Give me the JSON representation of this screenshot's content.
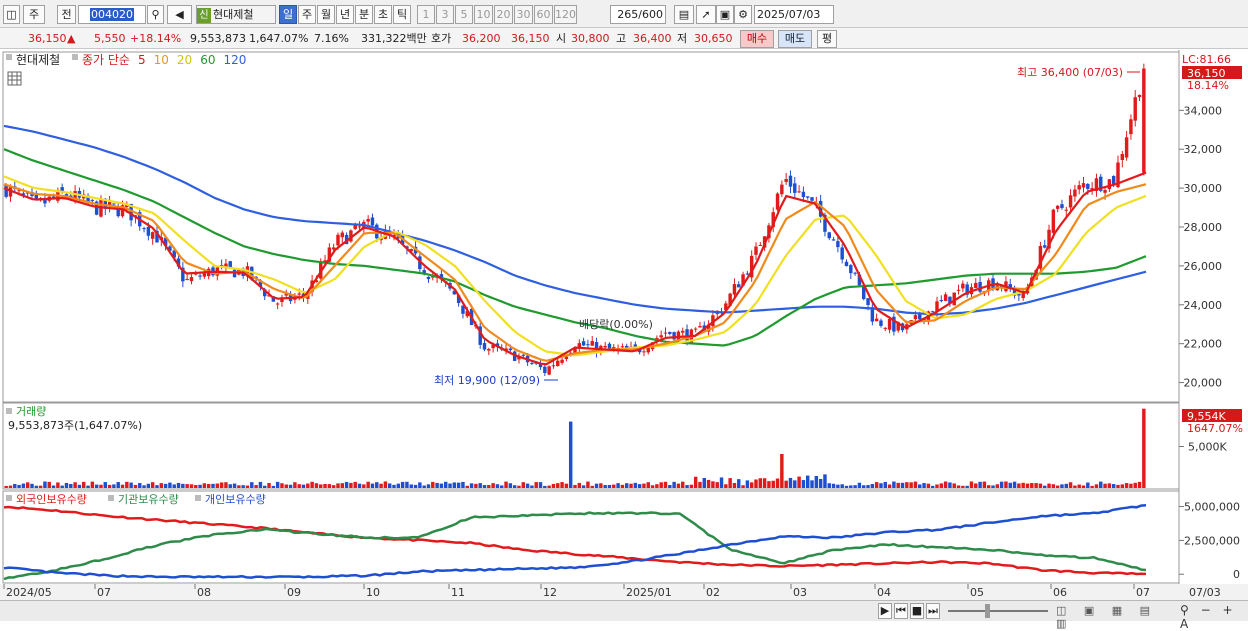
{
  "toolbar": {
    "period_main": "주",
    "period_prev": "전",
    "stock_code": "004020",
    "badge": "신",
    "stock_name": "현대제철",
    "periods": [
      "일",
      "주",
      "월",
      "년",
      "분",
      "초",
      "틱"
    ],
    "intervals": [
      "1",
      "3",
      "5",
      "10",
      "20",
      "30",
      "60",
      "120"
    ],
    "count": "265",
    "count_total": "/600",
    "date": "2025/07/03"
  },
  "quote": {
    "price": "36,150",
    "change": "5,550",
    "change_pct": "+18.14%",
    "volume": "9,553,873",
    "volume_pct": "1,647.07%",
    "turnover_pct": "7.16%",
    "trade_value": "331,322백만",
    "bid_label": "호가",
    "bid": "36,200",
    "ask": "36,150",
    "open_label": "시",
    "open": "30,800",
    "high_label": "고",
    "high": "36,400",
    "low_label": "저",
    "low": "30,650",
    "buy_label": "매수",
    "sell_label": "매도",
    "eval_label": "평"
  },
  "legend": {
    "stock": "현대제철",
    "ma_label": "종가 단순",
    "ma_periods": [
      "5",
      "10",
      "20",
      "60",
      "120"
    ],
    "lc": "LC:81.66",
    "last_price": "36,150",
    "last_pct": "18.14%",
    "max_note": "최고 36,400 (07/03)",
    "min_note": "최저 19,900 (12/09)",
    "dividend_note": "배당락(0.00%)"
  },
  "volume_panel": {
    "title": "거래량",
    "value": "9,553,873주(1,647.07%)",
    "last": "9,554K",
    "last_pct": "1647.07%",
    "axis_label": "5,000K"
  },
  "holders_panel": {
    "legends": [
      "외국인보유수량",
      "기관보유수량",
      "개인보유수량"
    ],
    "axis_labels": [
      "5,000,000",
      "2,500,000",
      "0"
    ]
  },
  "x_labels": [
    "2024/05",
    "07",
    "08",
    "09",
    "10",
    "11",
    "12",
    "2025/01",
    "02",
    "03",
    "04",
    "05",
    "06",
    "07",
    "07/03"
  ],
  "colors": {
    "up": "#e11b1b",
    "down": "#1f4fd1",
    "ma5": "#e11b1b",
    "ma10": "#f08a1a",
    "ma20": "#f0e020",
    "ma60": "#1f9a2f",
    "ma120": "#2f5fe0"
  },
  "chart_data": {
    "type": "candlestick",
    "y_range": [
      19000,
      37000
    ],
    "y_ticks": [
      20000,
      22000,
      24000,
      26000,
      28000,
      30000,
      32000,
      34000
    ],
    "y_tick_labels": [
      "20,000",
      "22,000",
      "24,000",
      "26,000",
      "28,000",
      "30,000",
      "32,000",
      "34,000"
    ],
    "price_path": [
      [
        "2024/05",
        30000
      ],
      [
        "2024/06",
        29100
      ],
      [
        "2024/06b",
        29700
      ],
      [
        "2024/07",
        29000
      ],
      [
        "2024/07b",
        28900
      ],
      [
        "2024/08",
        27600
      ],
      [
        "2024/08b",
        25200
      ],
      [
        "2024/08c",
        25800
      ],
      [
        "2024/09",
        25700
      ],
      [
        "2024/09b",
        24100
      ],
      [
        "2024/09c",
        24500
      ],
      [
        "2024/10",
        27200
      ],
      [
        "2024/10b",
        28100
      ],
      [
        "2024/10c",
        27300
      ],
      [
        "2024/11",
        25800
      ],
      [
        "2024/11b",
        24500
      ],
      [
        "2024/11c",
        21800
      ],
      [
        "2024/12",
        21400
      ],
      [
        "2024/12b",
        20600
      ],
      [
        "2024/12c",
        22000
      ],
      [
        "2025/01",
        21700
      ],
      [
        "2025/01b",
        21600
      ],
      [
        "2025/01c",
        22600
      ],
      [
        "2025/02",
        22400
      ],
      [
        "2025/02b",
        24000
      ],
      [
        "2025/03",
        26500
      ],
      [
        "2025/03b",
        30500
      ],
      [
        "2025/03c",
        29000
      ],
      [
        "2025/04",
        26500
      ],
      [
        "2025/04b",
        23200
      ],
      [
        "2025/04c",
        22700
      ],
      [
        "2025/05",
        23900
      ],
      [
        "2025/05b",
        24800
      ],
      [
        "2025/05c",
        25200
      ],
      [
        "2025/06",
        24400
      ],
      [
        "2025/06b",
        28600
      ],
      [
        "2025/06c",
        30200
      ],
      [
        "2025/07",
        30400
      ],
      [
        "2025/07/03",
        36150
      ]
    ],
    "series": [
      {
        "name": "5",
        "values": [
          30000,
          29400,
          29500,
          29050,
          28900,
          27900,
          25600,
          25700,
          25650,
          24300,
          24400,
          26800,
          28000,
          27500,
          26000,
          24800,
          22200,
          21400,
          20900,
          21800,
          21700,
          21600,
          22300,
          22400,
          23600,
          26000,
          29600,
          29200,
          27000,
          23800,
          22800,
          23600,
          24600,
          25100,
          24600,
          27800,
          29800,
          30200,
          30800
        ]
      },
      {
        "name": "10",
        "values": [
          30200,
          29700,
          29600,
          29200,
          29000,
          28300,
          26200,
          25600,
          25700,
          24800,
          24300,
          26000,
          27700,
          27700,
          26500,
          25300,
          22800,
          21700,
          21100,
          21500,
          21700,
          21700,
          22000,
          22400,
          23100,
          25200,
          28400,
          29300,
          28000,
          24800,
          23100,
          23200,
          24200,
          24900,
          24800,
          26600,
          29100,
          29800,
          30200
        ]
      },
      {
        "name": "20",
        "values": [
          30600,
          30000,
          29800,
          29500,
          29200,
          28700,
          27300,
          26000,
          25800,
          25300,
          24600,
          25300,
          27000,
          27800,
          27100,
          26000,
          24200,
          22600,
          21600,
          21400,
          21600,
          21800,
          21900,
          22200,
          22600,
          24000,
          26500,
          28400,
          28600,
          26600,
          24200,
          23300,
          23500,
          24300,
          24700,
          25600,
          27700,
          29000,
          29600
        ]
      },
      {
        "name": "60",
        "values": [
          32000,
          31400,
          30900,
          30400,
          29900,
          29300,
          28500,
          27700,
          27000,
          26600,
          26300,
          26100,
          26000,
          25800,
          25600,
          25200,
          24500,
          23900,
          23500,
          23100,
          22800,
          22400,
          22100,
          22000,
          21900,
          22400,
          23400,
          24300,
          24900,
          25000,
          25100,
          25300,
          25500,
          25600,
          25600,
          25600,
          25700,
          25900,
          26500
        ]
      },
      {
        "name": "120",
        "values": [
          33200,
          32900,
          32500,
          32100,
          31600,
          31000,
          30300,
          29500,
          28900,
          28500,
          28300,
          28200,
          28100,
          27700,
          27300,
          26800,
          26200,
          25500,
          25000,
          24600,
          24300,
          24000,
          23800,
          23700,
          23600,
          23700,
          23800,
          23900,
          23900,
          23800,
          23600,
          23500,
          23600,
          23800,
          24100,
          24500,
          24900,
          25300,
          25700
        ]
      }
    ],
    "volume": {
      "unit": "K",
      "ticks": [
        5000
      ],
      "spikes": [
        {
          "label": "2024/11",
          "value": 8000
        },
        {
          "label": "2025/03",
          "value": 4100
        },
        {
          "label": "2025/07/03",
          "value": 9554
        }
      ]
    },
    "holders": {
      "y_range": [
        -500000,
        6000000
      ],
      "series": [
        {
          "name": "외국인보유수량",
          "values": [
            5000000,
            4700000,
            4300000,
            4000000,
            3700000,
            3400000,
            3000000,
            2700000,
            2500000,
            2300000,
            1800000,
            1500000,
            1200000,
            900000,
            700000,
            600000,
            700000,
            800000,
            900000,
            800000,
            300000,
            100000,
            0
          ]
        },
        {
          "name": "기관보유수량",
          "values": [
            -300000,
            300000,
            1200000,
            2200000,
            2900000,
            3300000,
            3000000,
            2700000,
            2700000,
            4200000,
            4300000,
            4500000,
            4500000,
            4500000,
            1800000,
            800000,
            1800000,
            2200000,
            2000000,
            1800000,
            1400000,
            1200000,
            300000
          ]
        },
        {
          "name": "개인보유수량",
          "values": [
            500000,
            100000,
            -100000,
            -200000,
            -200000,
            -200000,
            -200000,
            -100000,
            200000,
            300000,
            400000,
            500000,
            900000,
            1500000,
            2200000,
            2800000,
            2700000,
            3100000,
            3300000,
            3800000,
            4300000,
            4500000,
            5100000
          ]
        }
      ]
    }
  }
}
